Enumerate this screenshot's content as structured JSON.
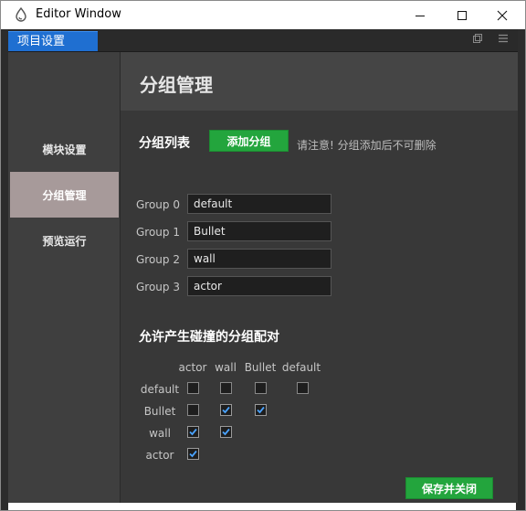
{
  "window": {
    "title": "Editor Window"
  },
  "tab": {
    "label": "项目设置"
  },
  "sidebar": {
    "items": [
      {
        "label": "模块设置",
        "active": false
      },
      {
        "label": "分组管理",
        "active": true
      },
      {
        "label": "预览运行",
        "active": false
      }
    ]
  },
  "page": {
    "title": "分组管理",
    "group_list_title": "分组列表",
    "add_group_label": "添加分组",
    "note": "请注意! 分组添加后不可删除",
    "groups": [
      {
        "label": "Group 0",
        "value": "default"
      },
      {
        "label": "Group 1",
        "value": "Bullet"
      },
      {
        "label": "Group 2",
        "value": "wall"
      },
      {
        "label": "Group 3",
        "value": "actor"
      }
    ],
    "collision_title": "允许产生碰撞的分组配对",
    "matrix": {
      "columns": [
        "actor",
        "wall",
        "Bullet",
        "default"
      ],
      "rows": [
        {
          "label": "default",
          "checks": [
            false,
            false,
            false,
            false
          ]
        },
        {
          "label": "Bullet",
          "checks": [
            false,
            true,
            true
          ]
        },
        {
          "label": "wall",
          "checks": [
            true,
            true
          ]
        },
        {
          "label": "actor",
          "checks": [
            true
          ]
        }
      ]
    },
    "save_label": "保存并关闭"
  },
  "colors": {
    "accent_green": "#23a53d",
    "tab_blue": "#1f6fd1",
    "active_sidebar": "#a79a9a",
    "check_blue": "#4aa3ff"
  }
}
